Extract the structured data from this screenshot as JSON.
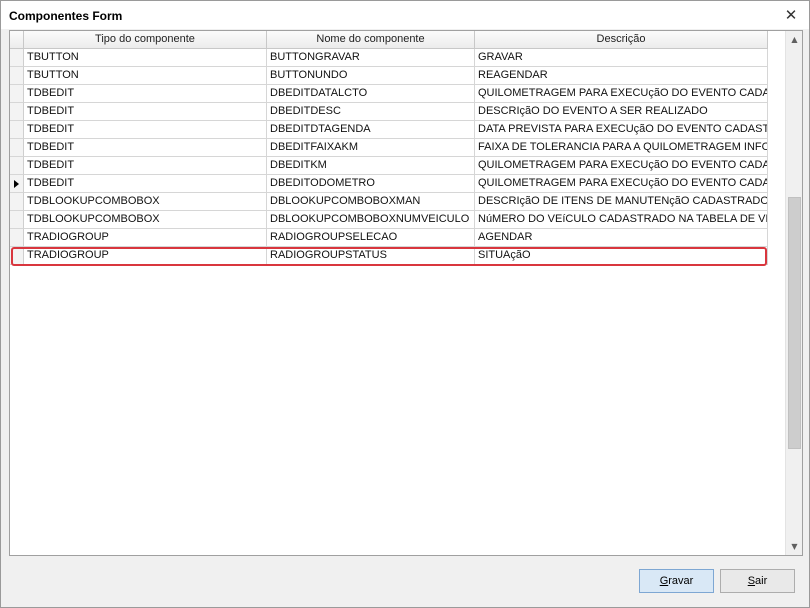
{
  "window": {
    "title": "Componentes Form"
  },
  "grid": {
    "columns": [
      {
        "label": "Tipo do componente"
      },
      {
        "label": "Nome do componente"
      },
      {
        "label": "Descrição"
      }
    ],
    "rows": [
      {
        "tipo": "TBUTTON",
        "nome": "BUTTONGRAVAR",
        "descricao": "GRAVAR",
        "current": false
      },
      {
        "tipo": "TBUTTON",
        "nome": "BUTTONUNDO",
        "descricao": "REAGENDAR",
        "current": false
      },
      {
        "tipo": "TDBEDIT",
        "nome": "DBEDITDATALCTO",
        "descricao": "QUILOMETRAGEM PARA EXECUçãO DO EVENTO CADASTRADO",
        "current": false
      },
      {
        "tipo": "TDBEDIT",
        "nome": "DBEDITDESC",
        "descricao": "DESCRIçãO DO EVENTO A SER REALIZADO",
        "current": false
      },
      {
        "tipo": "TDBEDIT",
        "nome": "DBEDITDTAGENDA",
        "descricao": "DATA PREVISTA PARA EXECUçãO DO EVENTO CADASTRADO",
        "current": false
      },
      {
        "tipo": "TDBEDIT",
        "nome": "DBEDITFAIXAKM",
        "descricao": "FAIXA DE TOLERANCIA PARA A QUILOMETRAGEM INFORMADA",
        "current": false
      },
      {
        "tipo": "TDBEDIT",
        "nome": "DBEDITKM",
        "descricao": "QUILOMETRAGEM PARA EXECUçãO DO EVENTO CADASTRADO",
        "current": false
      },
      {
        "tipo": "TDBEDIT",
        "nome": "DBEDITODOMETRO",
        "descricao": "QUILOMETRAGEM PARA EXECUçãO DO EVENTO CADASTRADO",
        "current": true
      },
      {
        "tipo": "TDBLOOKUPCOMBOBOX",
        "nome": "DBLOOKUPCOMBOBOXMAN",
        "descricao": "DESCRIçãO DE ITENS DE MANUTENçãO CADASTRADOS",
        "current": false
      },
      {
        "tipo": "TDBLOOKUPCOMBOBOX",
        "nome": "DBLOOKUPCOMBOBOXNUMVEICULO",
        "descricao": "NúMERO DO VEíCULO CADASTRADO NA TABELA DE VEÍCULOS",
        "current": false
      },
      {
        "tipo": "TRADIOGROUP",
        "nome": "RADIOGROUPSELECAO",
        "descricao": " AGENDAR",
        "current": false
      },
      {
        "tipo": "TRADIOGROUP",
        "nome": "RADIOGROUPSTATUS",
        "descricao": " SITUAçãO",
        "current": false
      }
    ],
    "highlighted_row_index": 11
  },
  "footer": {
    "save_label": "Gravar",
    "exit_label": "Sair"
  },
  "icons": {
    "close": "close-icon",
    "scroll_up": "arrow-up-icon",
    "scroll_down": "arrow-down-icon",
    "row_indicator": "caret-right-icon"
  },
  "colors": {
    "highlight_border": "#d9363e",
    "primary_button_bg": "#d9e8f6"
  }
}
